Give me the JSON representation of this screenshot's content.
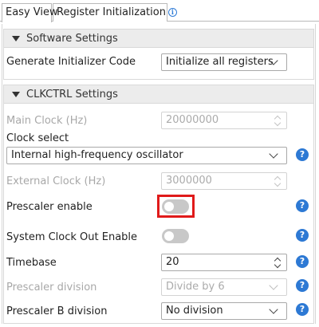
{
  "tabs": [
    {
      "label": "Easy View"
    },
    {
      "label": "Register Initialization"
    }
  ],
  "software_settings": {
    "title": "Software Settings",
    "generate_initializer_code": {
      "label": "Generate Initializer Code",
      "value": "Initialize all registers"
    }
  },
  "clkctrl_settings": {
    "title": "CLKCTRL Settings",
    "main_clock": {
      "label": "Main Clock (Hz)",
      "value": "20000000"
    },
    "clock_select": {
      "label": "Clock select",
      "value": "Internal high-frequency oscillator"
    },
    "external_clock": {
      "label": "External Clock (Hz)",
      "value": "3000000"
    },
    "prescaler_enable": {
      "label": "Prescaler enable",
      "on": false
    },
    "system_clock_out_enable": {
      "label": "System Clock Out Enable",
      "on": false
    },
    "timebase": {
      "label": "Timebase",
      "value": "20"
    },
    "prescaler_division": {
      "label": "Prescaler division",
      "value": "Divide by 6"
    },
    "prescaler_b_division": {
      "label": "Prescaler B division",
      "value": "No division"
    }
  },
  "colors": {
    "accent": "#2d79d4",
    "highlight": "#e01a1a"
  },
  "icons": {
    "info": "info-circle-icon",
    "help": "help-circle-icon"
  }
}
